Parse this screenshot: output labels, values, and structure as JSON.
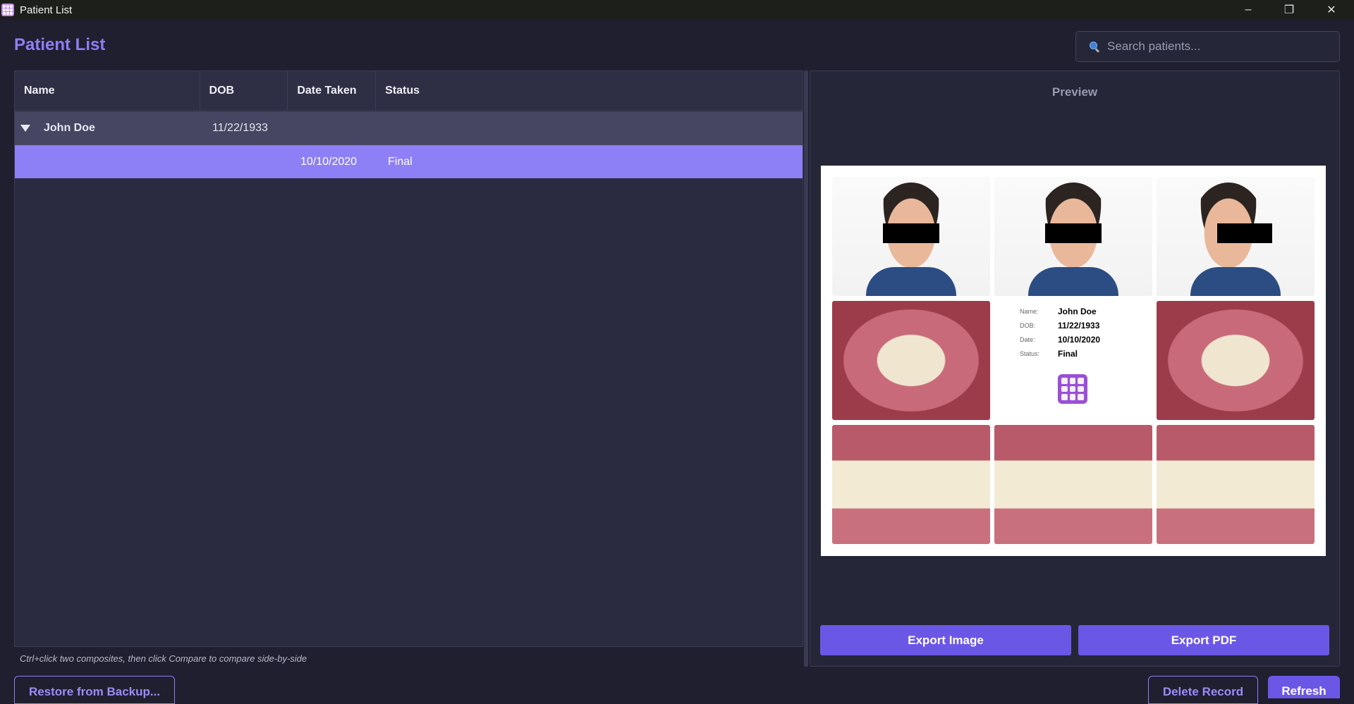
{
  "window": {
    "title": "Patient List",
    "controls": {
      "minimize": "–",
      "restore": "❐",
      "close": "✕"
    }
  },
  "header": {
    "title": "Patient List"
  },
  "search": {
    "placeholder": "Search patients..."
  },
  "table": {
    "columns": [
      "Name",
      "DOB",
      "Date Taken",
      "Status"
    ],
    "group": {
      "name": "John Doe",
      "dob": "11/22/1933"
    },
    "child": {
      "date_taken": "10/10/2020",
      "status": "Final"
    }
  },
  "hint": "Ctrl+click two composites, then click Compare to compare side-by-side",
  "preview": {
    "title": "Preview",
    "info": {
      "labels": [
        "Name:",
        "DOB:",
        "Date:",
        "Status:"
      ],
      "values": [
        "John Doe",
        "11/22/1933",
        "10/10/2020",
        "Final"
      ]
    }
  },
  "buttons": {
    "export_image": "Export Image",
    "export_pdf": "Export PDF",
    "restore": "Restore from Backup...",
    "delete": "Delete Record",
    "refresh": "Refresh"
  },
  "colors": {
    "accent": "#6b57e6",
    "selected_row": "#8d7ff5",
    "title": "#8f7df5"
  }
}
